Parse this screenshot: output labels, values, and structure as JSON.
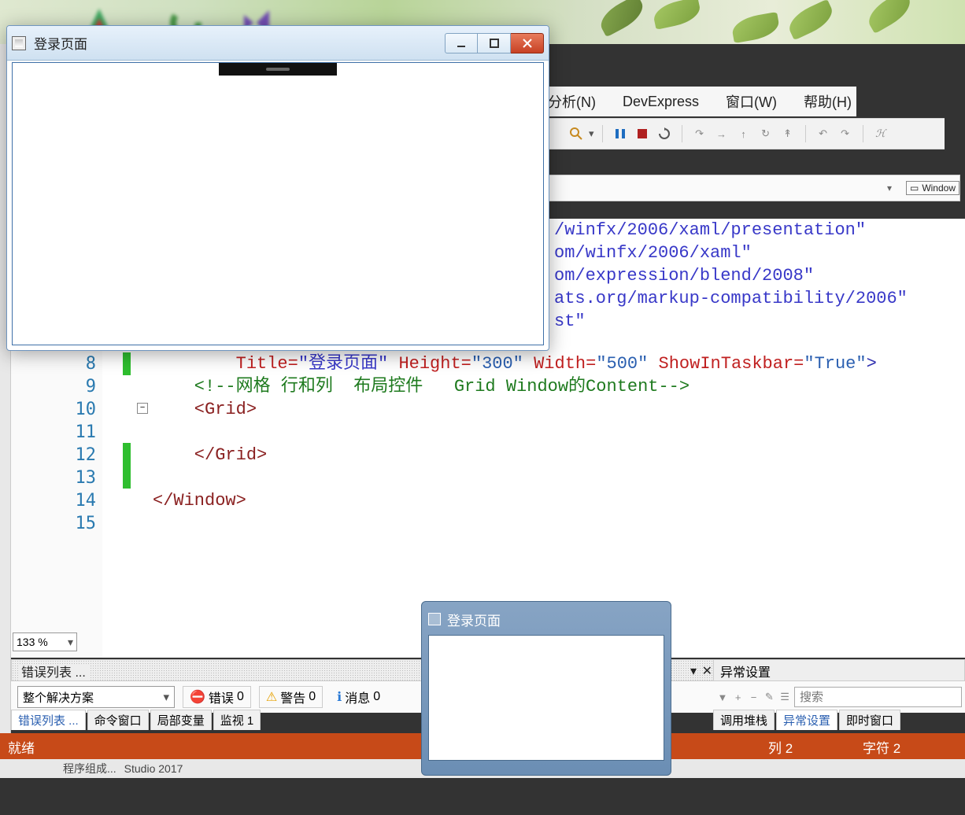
{
  "app_window": {
    "title": "登录页面",
    "buttons": {
      "min": "min",
      "max": "max",
      "close": "close"
    }
  },
  "ide": {
    "menu": {
      "analyze": "分析(N)",
      "devexpress": "DevExpress",
      "window": "窗口(W)",
      "help": "帮助(H)"
    },
    "scope": {
      "label": "Window"
    },
    "zoom": "133 %",
    "line_numbers": [
      "8",
      "9",
      "10",
      "11",
      "12",
      "13",
      "14",
      "15"
    ],
    "code": {
      "urls": {
        "presentation": "/winfx/2006/xaml/presentation\"",
        "xaml": "om/winfx/2006/xaml\"",
        "blend": "om/expression/blend/2008\"",
        "markup": "ats.org/markup-compatibility/2006\"",
        "st": "st\""
      },
      "line8_pre": "        Title=",
      "line8_title": "\"登录页面\"",
      "line8_h": " Height=",
      "line8_hv": "\"300\"",
      "line8_w": " Width=",
      "line8_wv": "\"500\"",
      "line8_sit": " ShowInTaskbar=",
      "line8_sitv": "\"True\"",
      "line8_end": ">",
      "line9": "    <!--网格 行和列  布局控件   Grid Window的Content-->",
      "line10": "    <Grid>",
      "line11": "        ",
      "line12": "    </Grid>",
      "line13": "",
      "line14": "</Window>"
    }
  },
  "error_panel": {
    "title": "错误列表 ...",
    "scope": "整个解决方案",
    "errors_label": "错误",
    "errors_count": "0",
    "warnings_label": "警告",
    "warnings_count": "0",
    "messages_label": "消息",
    "messages_count": "0"
  },
  "bottom_tabs": {
    "t1": "错误列表 ...",
    "t2": "命令窗口",
    "t3": "局部变量",
    "t4": "监视 1"
  },
  "exc_panel": {
    "title": "异常设置",
    "search_placeholder": "搜索",
    "tab1": "调用堆栈",
    "tab2": "异常设置",
    "tab3": "即时窗口"
  },
  "status": {
    "ready": "就绪",
    "col": "列 2",
    "ch": "字符 2"
  },
  "footer": {
    "a": "程序组成...",
    "b": "Studio 2017"
  },
  "preview": {
    "title": "登录页面"
  }
}
